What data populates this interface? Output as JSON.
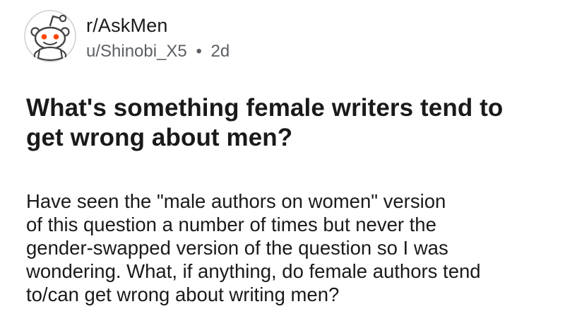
{
  "post": {
    "subreddit": "r/AskMen",
    "author": "u/Shinobi_X5",
    "separator": "•",
    "age": "2d",
    "title_line1": "What's something female writers tend to",
    "title_line2": "get wrong about men?",
    "body_lines": [
      "Have seen the \"male authors on women\" version",
      "of this question a number of times but never the",
      "gender-swapped version of the question so I was",
      "wondering. What, if anything, do female authors tend",
      "to/can get wrong about writing men?"
    ]
  },
  "icons": {
    "avatar": "reddit-snoo-icon"
  },
  "colors": {
    "text": "#1a1a1b",
    "meta_text": "#5c5f63",
    "snoo_eye": "#ff4500",
    "avatar_bg": "#e9e9e9",
    "background": "#ffffff"
  }
}
